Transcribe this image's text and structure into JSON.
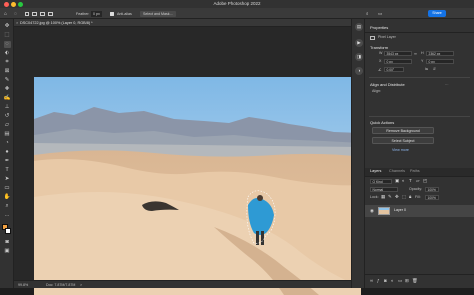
{
  "app": {
    "title": "Adobe Photoshop 2022"
  },
  "options": {
    "feather_label": "Feather:",
    "feather_value": "0 px",
    "anti_alias_label": "Anti-alias",
    "select_mask_label": "Select and Mask..."
  },
  "share_label": "Share",
  "document": {
    "tab_label": "DSC04722.jpg @ 100% (Layer 0, RGB/8) *",
    "close_icon": "×"
  },
  "status": {
    "zoom": "99.8%",
    "doc_info": "Doc: 7.87M/7.87M",
    "arrow": ">"
  },
  "properties": {
    "tab_label": "Properties",
    "layer_type": "Pixel Layer",
    "transform_title": "Transform",
    "w_label": "W",
    "w_value": "3543 px",
    "h_label": "H",
    "h_value": "2362 px",
    "x_label": "X",
    "x_value": "0 px",
    "y_label": "Y",
    "y_value": "0 px",
    "angle_value": "0.00°",
    "align_title": "Align and Distribute",
    "align_sublabel": "Align:",
    "quick_actions_title": "Quick Actions",
    "remove_bg_label": "Remove Background",
    "select_subject_label": "Select Subject",
    "view_more_label": "View more"
  },
  "layers": {
    "tabs": [
      "Layers",
      "Channels",
      "Paths"
    ],
    "kind_label": "Q Kind",
    "blend_mode": "Normal",
    "opacity_label": "Opacity:",
    "opacity_value": "100%",
    "lock_label": "Lock:",
    "fill_label": "Fill:",
    "fill_value": "100%",
    "layer_name": "Layer 0"
  },
  "colors": {
    "accent": "#1473e6",
    "sky": "#8ec3ea",
    "sand": "#e2c3a0",
    "figure": "#2e9ad4"
  }
}
